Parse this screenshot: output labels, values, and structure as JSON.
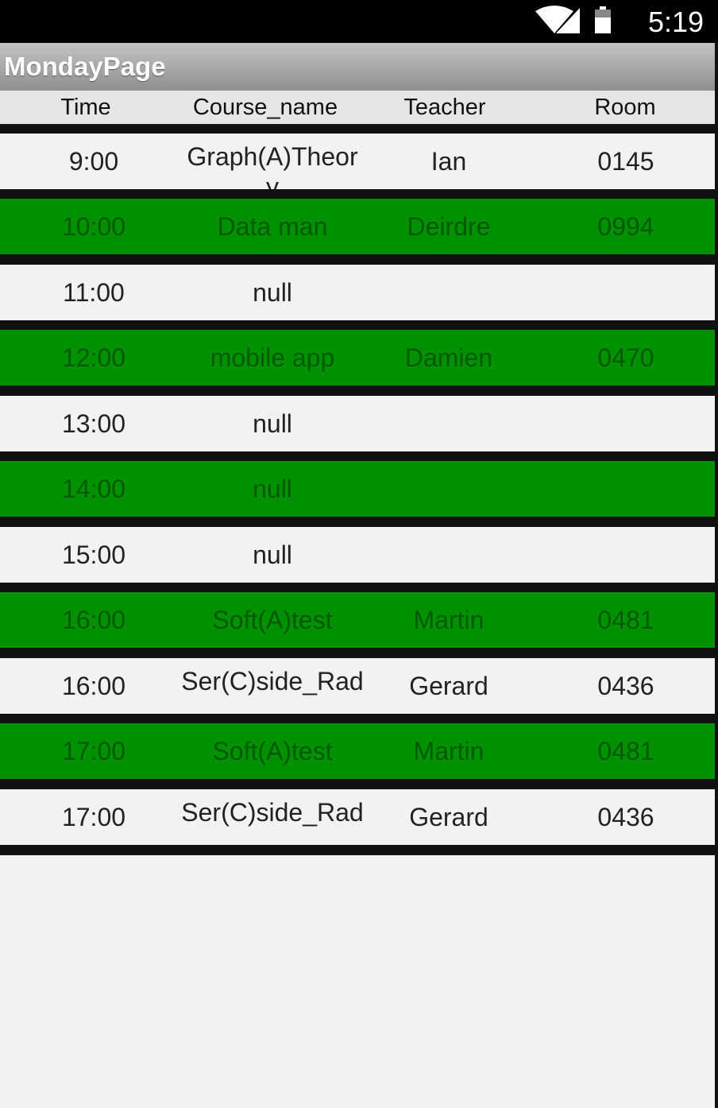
{
  "status_bar": {
    "time": "5:19",
    "icons": [
      "wifi-icon",
      "signal-icon",
      "battery-icon"
    ]
  },
  "app_bar": {
    "title": "MondayPage"
  },
  "columns": [
    "Time",
    "Course_name",
    "Teacher",
    "Room"
  ],
  "colors": {
    "green_row": "#009100",
    "green_text": "#005a00",
    "light_row": "#f2f2f2",
    "separator": "#111111"
  },
  "rows": [
    {
      "time": "9:00",
      "course": "Graph(A)Theory",
      "teacher": "Ian",
      "room": "0145",
      "style": "light"
    },
    {
      "time": "10:00",
      "course": "Data man",
      "teacher": "Deirdre",
      "room": "0994",
      "style": "green"
    },
    {
      "time": "11:00",
      "course": "null",
      "teacher": "",
      "room": "",
      "style": "light"
    },
    {
      "time": "12:00",
      "course": "mobile app",
      "teacher": "Damien",
      "room": "0470",
      "style": "green"
    },
    {
      "time": "13:00",
      "course": "null",
      "teacher": "",
      "room": "",
      "style": "light"
    },
    {
      "time": "14:00",
      "course": "null",
      "teacher": "",
      "room": "",
      "style": "green"
    },
    {
      "time": "15:00",
      "course": "null",
      "teacher": "",
      "room": "",
      "style": "light"
    },
    {
      "time": "16:00",
      "course": "Soft(A)test",
      "teacher": "Martin",
      "room": "0481",
      "style": "green"
    },
    {
      "time": "16:00",
      "course": "Ser(C)side_Rad",
      "teacher": "Gerard",
      "room": "0436",
      "style": "light"
    },
    {
      "time": "17:00",
      "course": "Soft(A)test",
      "teacher": "Martin",
      "room": "0481",
      "style": "green"
    },
    {
      "time": "17:00",
      "course": "Ser(C)side_Rad",
      "teacher": "Gerard",
      "room": "0436",
      "style": "light"
    }
  ]
}
